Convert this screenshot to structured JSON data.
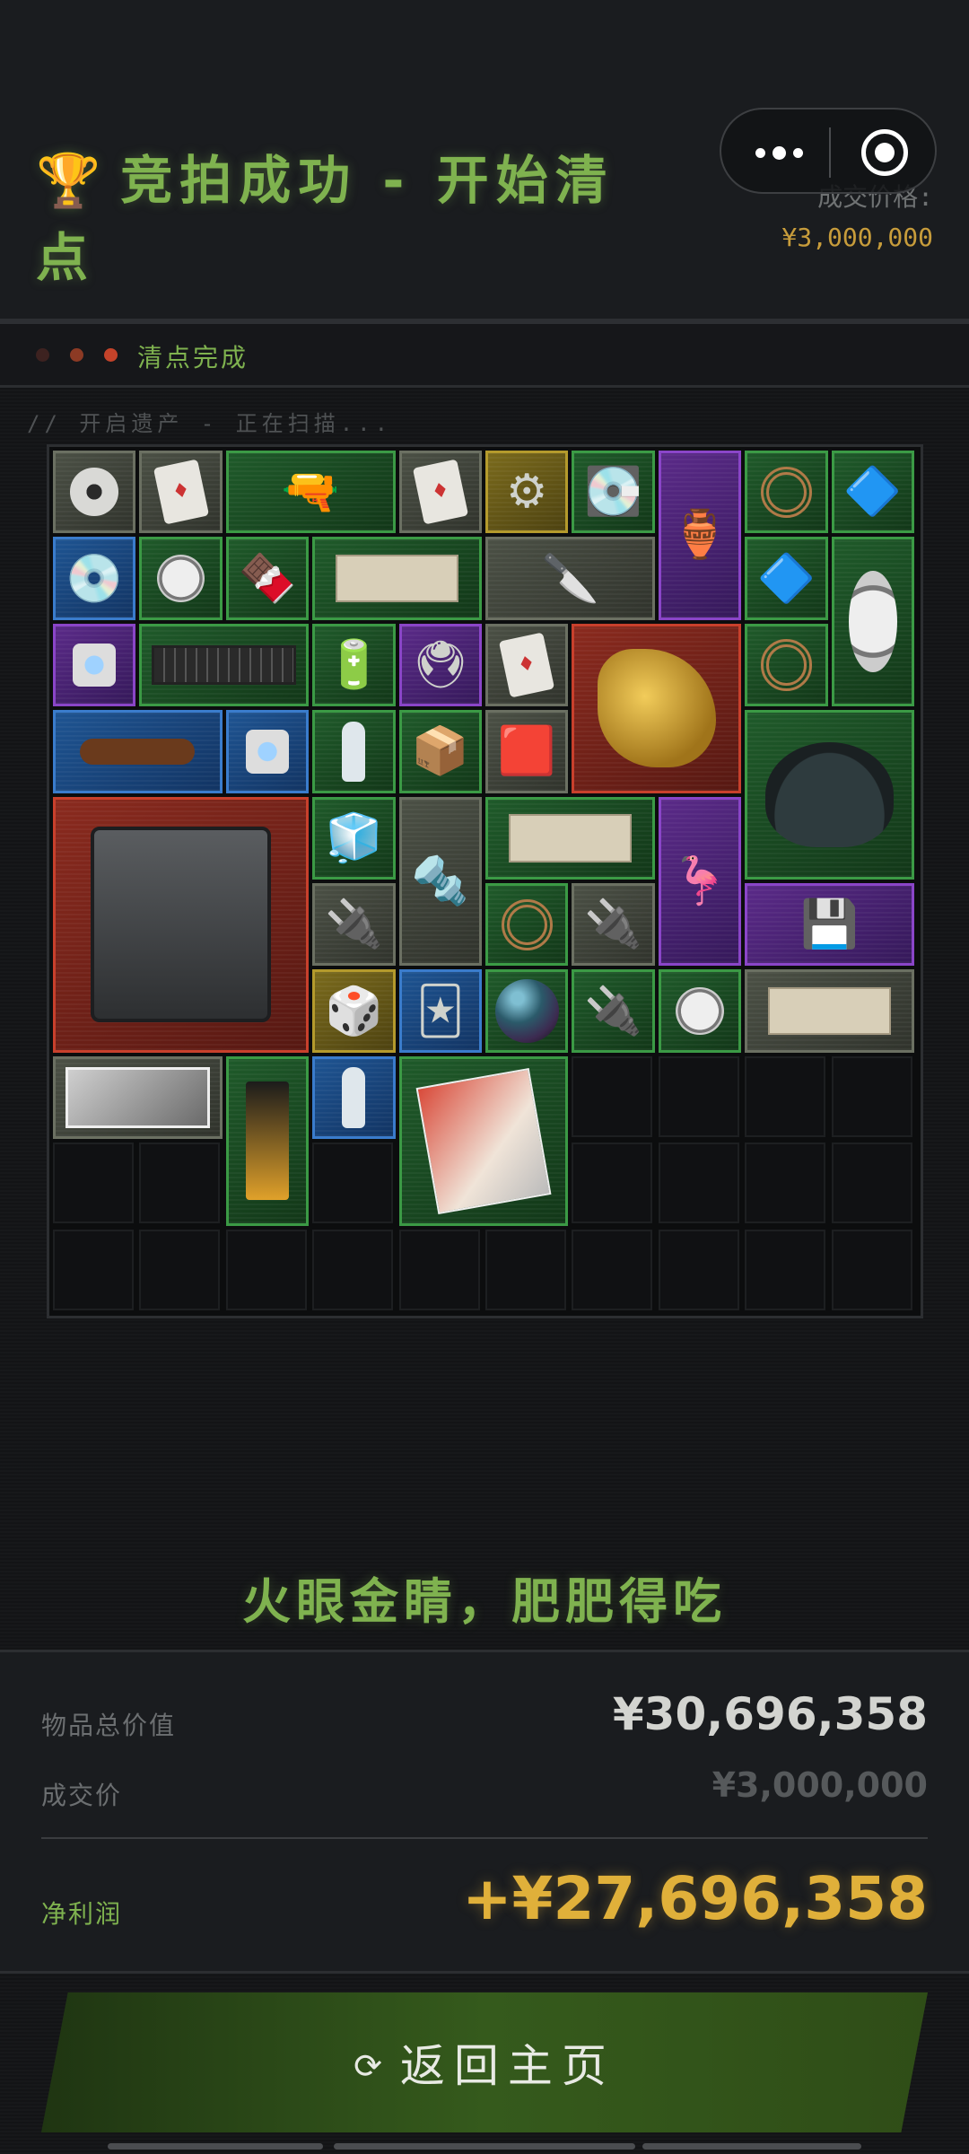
{
  "header": {
    "trophy_icon": "🏆",
    "title": "竞拍成功 - 开始清点",
    "price_label": "成交价格:",
    "price_value": "¥3,000,000"
  },
  "status": {
    "text": "清点完成"
  },
  "scan_text": "// 开启遗产 - 正在扫描...",
  "colors": {
    "accent_green": "#7fb24f",
    "gold": "#e0b03a",
    "rarity_gray": "#6b7062",
    "rarity_green": "#3b9a45",
    "rarity_blue": "#3a7ccc",
    "rarity_purple": "#8a45c8",
    "rarity_gold": "#b49a2c",
    "rarity_red": "#c8402c"
  },
  "grid": {
    "columns": 10,
    "rows": 10,
    "items": [
      {
        "icon": "tape-roll-icon",
        "rarity": "gray"
      },
      {
        "icon": "playing-card-icon",
        "rarity": "gray"
      },
      {
        "icon": "power-drill-icon",
        "rarity": "green"
      },
      {
        "icon": "playing-card-icon",
        "rarity": "gray"
      },
      {
        "icon": "robot-vacuum-part-icon",
        "rarity": "gold"
      },
      {
        "icon": "hard-drive-icon",
        "rarity": "green"
      },
      {
        "icon": "brass-hookah-icon",
        "rarity": "purple"
      },
      {
        "icon": "hose-coil-icon",
        "rarity": "green"
      },
      {
        "icon": "blue-device-icon",
        "rarity": "green"
      },
      {
        "icon": "dvd-disc-icon",
        "rarity": "blue"
      },
      {
        "icon": "thermometer-gauge-icon",
        "rarity": "green"
      },
      {
        "icon": "energy-bar-icon",
        "rarity": "green"
      },
      {
        "icon": "old-paper-icon",
        "rarity": "green"
      },
      {
        "icon": "utility-knife-icon",
        "rarity": "gray"
      },
      {
        "icon": "blue-device-icon",
        "rarity": "green"
      },
      {
        "icon": "pressure-gauge-icon",
        "rarity": "green"
      },
      {
        "icon": "tin-can-icon",
        "rarity": "purple"
      },
      {
        "icon": "keyboard-icon",
        "rarity": "green"
      },
      {
        "icon": "battery-pack-icon",
        "rarity": "green"
      },
      {
        "icon": "circuit-board-icon",
        "rarity": "purple"
      },
      {
        "icon": "playing-card-icon",
        "rarity": "gray"
      },
      {
        "icon": "golden-crocodile-head-icon",
        "rarity": "red"
      },
      {
        "icon": "hose-coil-icon",
        "rarity": "green"
      },
      {
        "icon": "tobacco-pipe-icon",
        "rarity": "blue"
      },
      {
        "icon": "jar-icon",
        "rarity": "blue"
      },
      {
        "icon": "water-bottle-icon",
        "rarity": "green"
      },
      {
        "icon": "ration-pack-icon",
        "rarity": "green"
      },
      {
        "icon": "matchbox-icon",
        "rarity": "gray"
      },
      {
        "icon": "ceramic-pot-icon",
        "rarity": "green"
      },
      {
        "icon": "robot-vacuum-station-icon",
        "rarity": "red"
      },
      {
        "icon": "cpu-cooler-icon",
        "rarity": "green"
      },
      {
        "icon": "bolt-icon",
        "rarity": "gray"
      },
      {
        "icon": "old-paper-icon",
        "rarity": "green"
      },
      {
        "icon": "golden-figurine-icon",
        "rarity": "purple"
      },
      {
        "icon": "power-adapter-icon",
        "rarity": "gray"
      },
      {
        "icon": "cable-coil-icon",
        "rarity": "green"
      },
      {
        "icon": "power-adapter-icon",
        "rarity": "gray"
      },
      {
        "icon": "ssd-package-icon",
        "rarity": "purple"
      },
      {
        "icon": "portal-cube-icon",
        "rarity": "gold"
      },
      {
        "icon": "sd-card-icon",
        "rarity": "blue"
      },
      {
        "icon": "marble-sphere-icon",
        "rarity": "green"
      },
      {
        "icon": "power-strip-icon",
        "rarity": "green"
      },
      {
        "icon": "thermometer-gauge-icon",
        "rarity": "green"
      },
      {
        "icon": "newspaper-icon",
        "rarity": "gray"
      },
      {
        "icon": "old-photo-icon",
        "rarity": "gray"
      },
      {
        "icon": "coffee-bag-icon",
        "rarity": "green"
      },
      {
        "icon": "milk-bottle-icon",
        "rarity": "blue"
      },
      {
        "icon": "magazine-icon",
        "rarity": "green"
      }
    ]
  },
  "slogan": "火眼金睛，肥肥得吃",
  "summary": {
    "total_label": "物品总价值",
    "total_value": "¥30,696,358",
    "deal_label": "成交价",
    "deal_value": "¥3,000,000",
    "profit_label": "净利润",
    "profit_value": "+¥27,696,358"
  },
  "home_button": {
    "reload_icon": "⟳",
    "label": "返回主页"
  }
}
